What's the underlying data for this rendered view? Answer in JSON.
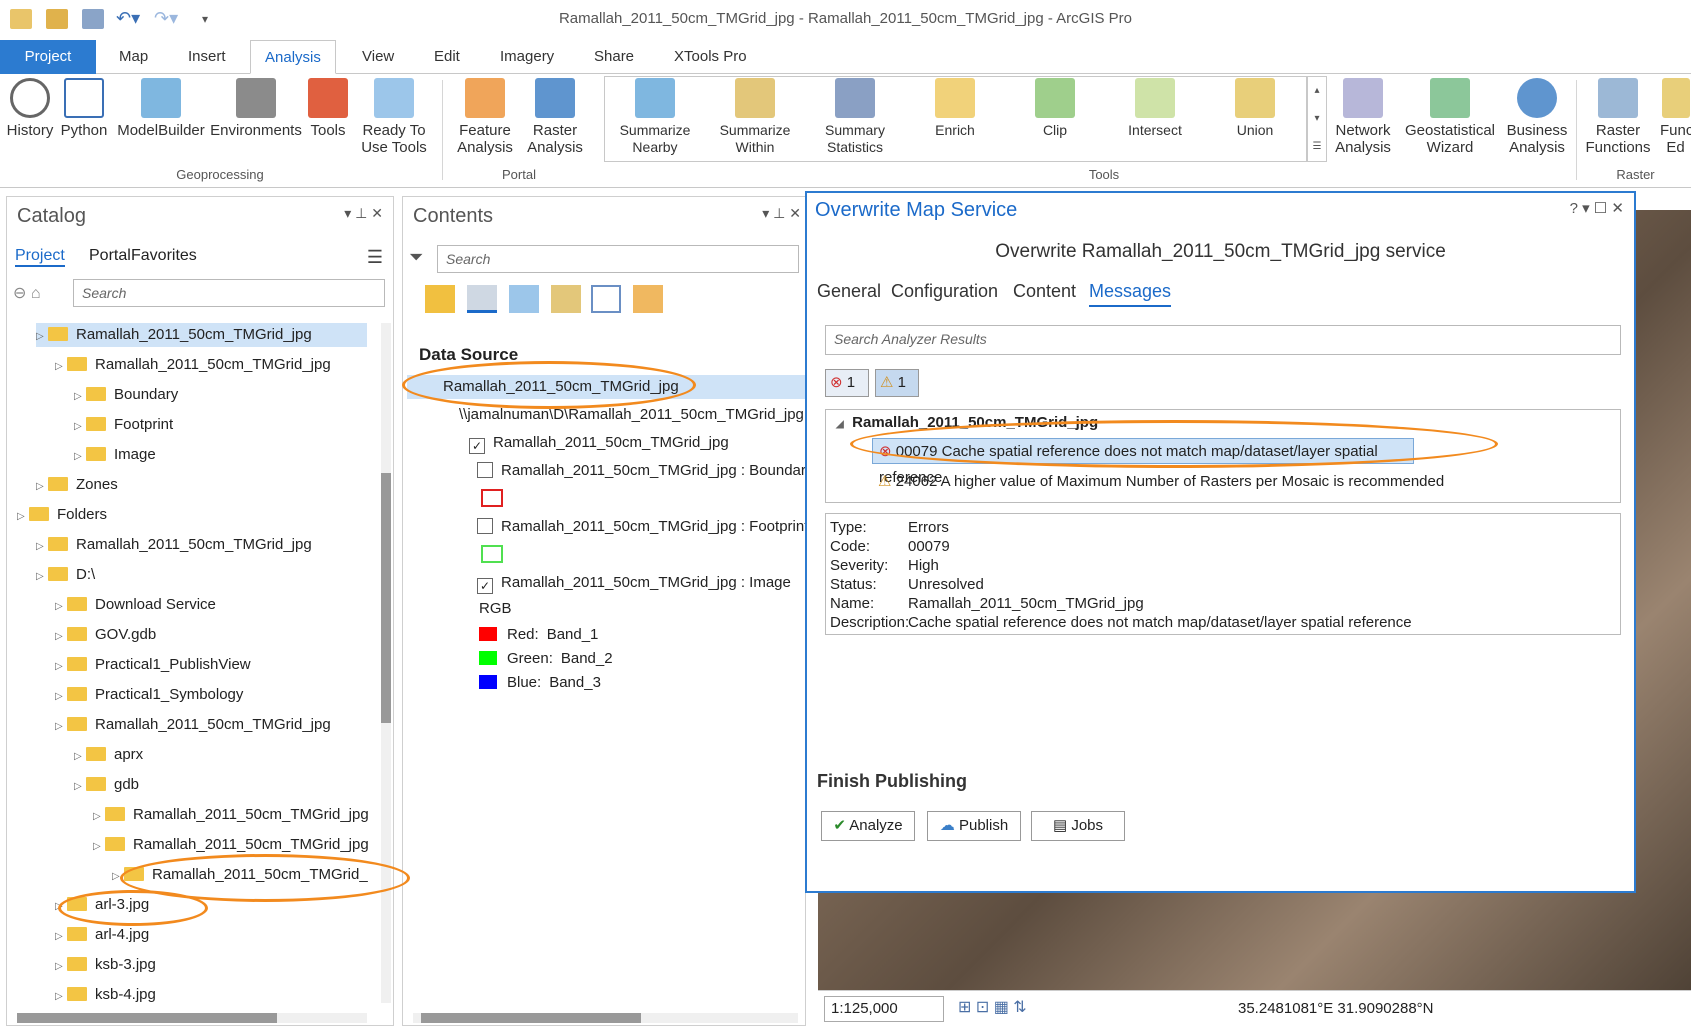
{
  "window": {
    "title": "Ramallah_2011_50cm_TMGrid_jpg - Ramallah_2011_50cm_TMGrid_jpg - ArcGIS Pro"
  },
  "quick_access": [
    "new-project-icon",
    "open-icon",
    "save-icon",
    "undo-icon",
    "redo-icon",
    "customize-icon"
  ],
  "tabs": [
    "Project",
    "Map",
    "Insert",
    "Analysis",
    "View",
    "Edit",
    "Imagery",
    "Share",
    "XTools Pro"
  ],
  "ribbon": {
    "geoprocessing": [
      "History",
      "Python",
      "ModelBuilder",
      "Environments",
      "Tools",
      "Ready To\nUse Tools"
    ],
    "geoprocessing_label": "Geoprocessing",
    "portal": [
      "Feature\nAnalysis",
      "Raster\nAnalysis"
    ],
    "portal_label": "Portal",
    "tools": [
      "Summarize\nNearby",
      "Summarize\nWithin",
      "Summary\nStatistics",
      "Enrich",
      "Clip",
      "Intersect",
      "Union"
    ],
    "tools_label": "Tools",
    "extra": [
      "Network\nAnalysis",
      "Geostatistical\nWizard",
      "Business\nAnalysis",
      "Raster\nFunctions",
      "Func\nEd"
    ],
    "raster_label": "Raster"
  },
  "catalog": {
    "title": "Catalog",
    "tabs": [
      "Project",
      "Portal",
      "Favorites"
    ],
    "search_placeholder": "Search",
    "rows": [
      {
        "label": "Ramallah_2011_50cm_TMGrid_jpg",
        "indent": 1,
        "sel": true
      },
      {
        "label": "Ramallah_2011_50cm_TMGrid_jpg",
        "indent": 2
      },
      {
        "label": "Boundary",
        "indent": 3
      },
      {
        "label": "Footprint",
        "indent": 3
      },
      {
        "label": "Image",
        "indent": 3
      },
      {
        "label": "Zones",
        "indent": 1
      },
      {
        "label": "Folders",
        "indent": 0
      },
      {
        "label": "Ramallah_2011_50cm_TMGrid_jpg",
        "indent": 1
      },
      {
        "label": "D:\\",
        "indent": 1
      },
      {
        "label": "Download Service",
        "indent": 2
      },
      {
        "label": "GOV.gdb",
        "indent": 2
      },
      {
        "label": "Practical1_PublishView",
        "indent": 2
      },
      {
        "label": "Practical1_Symbology",
        "indent": 2
      },
      {
        "label": "Ramallah_2011_50cm_TMGrid_jpg",
        "indent": 2
      },
      {
        "label": "aprx",
        "indent": 3
      },
      {
        "label": "gdb",
        "indent": 3
      },
      {
        "label": "Ramallah_2011_50cm_TMGrid_jpg",
        "indent": 4
      },
      {
        "label": "Ramallah_2011_50cm_TMGrid_jpg",
        "indent": 4
      },
      {
        "label": "Ramallah_2011_50cm_TMGrid_",
        "indent": 5
      },
      {
        "label": "arl-3.jpg",
        "indent": 2
      },
      {
        "label": "arl-4.jpg",
        "indent": 2
      },
      {
        "label": "ksb-3.jpg",
        "indent": 2
      },
      {
        "label": "ksb-4.jpg",
        "indent": 2
      }
    ]
  },
  "contents": {
    "title": "Contents",
    "search_placeholder": "Search",
    "section": "Data Source",
    "rows": [
      "Ramallah_2011_50cm_TMGrid_jpg",
      "\\\\jamalnuman\\D\\Ramallah_2011_50cm_TMGrid_jpg",
      "Ramallah_2011_50cm_TMGrid_jpg",
      "Ramallah_2011_50cm_TMGrid_jpg : Boundary",
      "Ramallah_2011_50cm_TMGrid_jpg : Footprint",
      "Ramallah_2011_50cm_TMGrid_jpg : Image"
    ],
    "rgb_label": "RGB",
    "bands": [
      {
        "name": "Red:",
        "band": "Band_1",
        "color": "#ff0000"
      },
      {
        "name": "Green:",
        "band": "Band_2",
        "color": "#00ff00"
      },
      {
        "name": "Blue:",
        "band": "Band_3",
        "color": "#0000ff"
      }
    ]
  },
  "dialog": {
    "title": "Overwrite Map Service",
    "subtitle": "Overwrite Ramallah_2011_50cm_TMGrid_jpg service",
    "tabs": [
      "General",
      "Configuration",
      "Content",
      "Messages"
    ],
    "search_placeholder": "Search Analyzer Results",
    "error_count": "1",
    "warning_count": "1",
    "group": "Ramallah_2011_50cm_TMGrid_jpg",
    "messages": [
      "00079 Cache spatial reference does not match map/dataset/layer spatial reference",
      "24062 A higher value of Maximum Number of Rasters per Mosaic is recommended"
    ],
    "details": [
      {
        "k": "Type:",
        "v": "Errors"
      },
      {
        "k": "Code:",
        "v": "00079"
      },
      {
        "k": "Severity:",
        "v": "High"
      },
      {
        "k": "Status:",
        "v": "Unresolved"
      },
      {
        "k": "Name:",
        "v": "Ramallah_2011_50cm_TMGrid_jpg"
      },
      {
        "k": "Description:",
        "v": "Cache spatial reference does not match map/dataset/layer spatial reference"
      }
    ],
    "finish": "Finish Publishing",
    "buttons": [
      "Analyze",
      "Publish",
      "Jobs"
    ],
    "help": "?"
  },
  "status": {
    "scale": "1:125,000",
    "coords": "35.2481081°E 31.9090288°N"
  }
}
